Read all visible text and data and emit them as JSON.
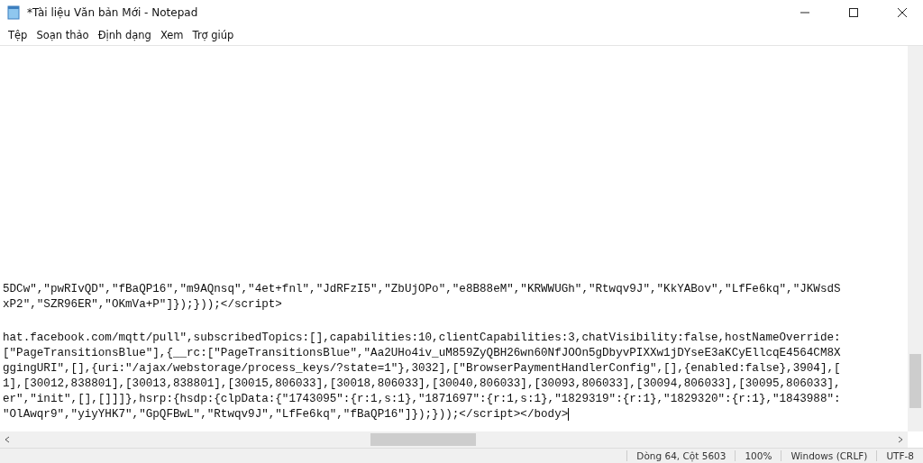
{
  "window": {
    "title": "*Tài liệu Văn bản Mới - Notepad"
  },
  "menu": [
    "Tệp",
    "Soạn thảo",
    "Định dạng",
    "Xem",
    "Trợ giúp"
  ],
  "editor": {
    "blocks": [
      [
        "5DCw\",\"pwRIvQD\",\"fBaQP16\",\"m9AQnsq\",\"4et+fnl\",\"JdRFzI5\",\"ZbUjOPo\",\"e8B88eM\",\"KRWWUGh\",\"Rtwqv9J\",\"KkYABov\",\"LfFe6kq\",\"JKWsdS",
        "xP2\",\"SZR96ER\",\"OKmVa+P\"]});}));</script>"
      ],
      [
        "hat.facebook.com/mqtt/pull\",subscribedTopics:[],capabilities:10,clientCapabilities:3,chatVisibility:false,hostNameOverride:",
        "[\"PageTransitionsBlue\"],{__rc:[\"PageTransitionsBlue\",\"Aa2UHo4iv_uM859ZyQBH26wn60NfJOOn5gDbyvPIXXw1jDYseE3aKCyEllcqE4564CM8X",
        "ggingURI\",[],{uri:\"/ajax/webstorage/process_keys/?state=1\"},3032],[\"BrowserPaymentHandlerConfig\",[],{enabled:false},3904],[",
        "1],[30012,838801],[30013,838801],[30015,806033],[30018,806033],[30040,806033],[30093,806033],[30094,806033],[30095,806033],",
        "er\",\"init\",[],[]]]},hsrp:{hsdp:{clpData:{\"1743095\":{r:1,s:1},\"1871697\":{r:1,s:1},\"1829319\":{r:1},\"1829320\":{r:1},\"1843988\":",
        "\"OlAwqr9\",\"yiyYHK7\",\"GpQFBwL\",\"Rtwqv9J\",\"LfFe6kq\",\"fBaQP16\"]});}));</script></body>"
      ]
    ]
  },
  "status_bar": [
    "Dòng 64, Cột 5603",
    "100%",
    "Windows (CRLF)",
    "UTF-8"
  ]
}
